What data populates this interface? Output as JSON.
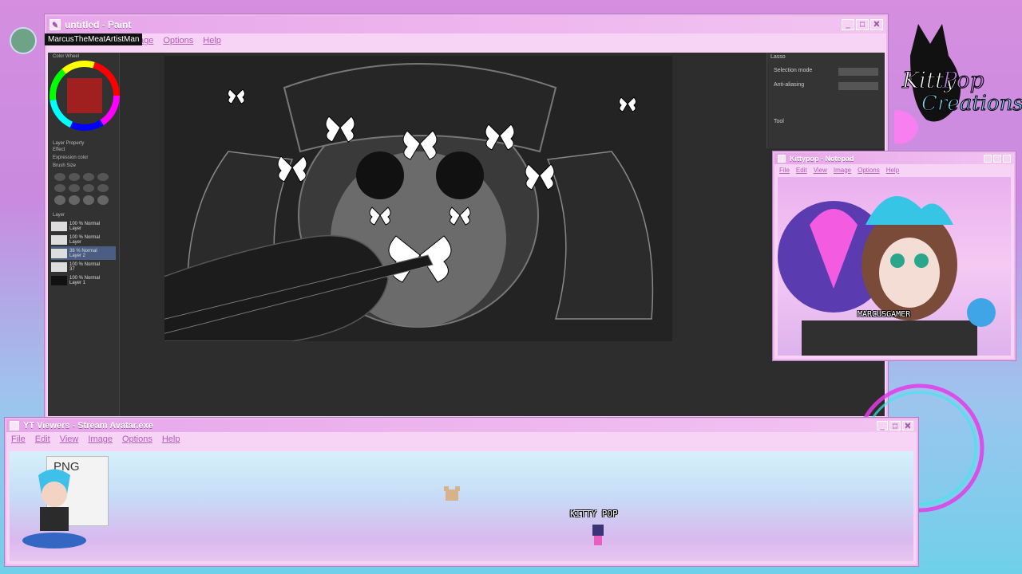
{
  "paint": {
    "title": "untitled - Paint",
    "menu": [
      "age",
      "Options",
      "Help"
    ],
    "username": "MarcusTheMeatArtistMan",
    "panels": {
      "color_wheel": "Color Wheel",
      "layer_props": "Layer Property",
      "effect": "Effect",
      "expression_color": "Expression color",
      "brush_size": "Brush Size",
      "layer": "Layer",
      "lasso": "Lasso",
      "selection_mode": "Selection mode",
      "anti_aliasing": "Anti-aliasing",
      "tool": "Tool"
    },
    "layers": [
      {
        "label": "100 % Normal",
        "name": "Layer"
      },
      {
        "label": "100 % Normal",
        "name": "Layer"
      },
      {
        "label": "36 % Normal",
        "name": "Layer 2"
      },
      {
        "label": "100 % Normal",
        "name": "37"
      },
      {
        "label": "100 % Normal",
        "name": "Layer 1"
      }
    ]
  },
  "notepad": {
    "title": "Kittypop - Notepad",
    "menu": [
      "File",
      "Edit",
      "View",
      "Image",
      "Options",
      "Help"
    ],
    "gamer_tag": "MARCUSGAMER"
  },
  "yt": {
    "title": "YT Viewers - Stream Avatar.exe",
    "menu": [
      "File",
      "Edit",
      "View",
      "Image",
      "Options",
      "Help"
    ],
    "png_label": "PNG",
    "avatar_name": "KITTY POP"
  },
  "logo": {
    "line1": "Kitty Pop",
    "line2": "Creations"
  },
  "colors": {
    "window_title": "#e7a6ea",
    "menu_text": "#b05db3",
    "canvas_bg": "#2d2d2d"
  }
}
